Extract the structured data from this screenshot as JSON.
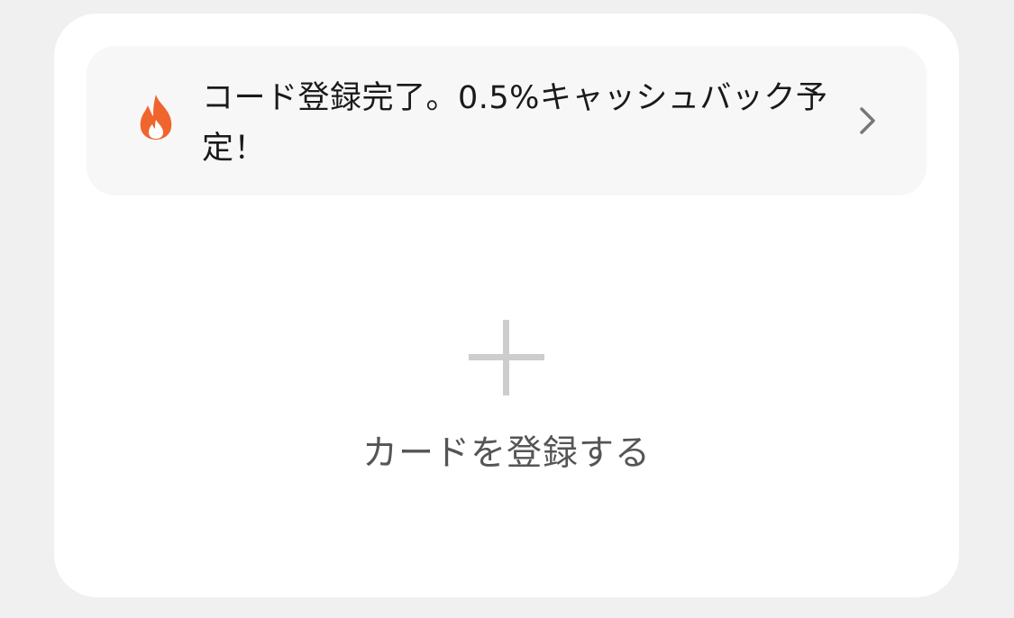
{
  "colors": {
    "page_background": "#f0f0f0",
    "card_background": "#ffffff",
    "banner_background": "#f7f7f7",
    "fire_accent": "#f0642e",
    "plus_color": "#cdcdcd",
    "chevron_color": "#777777"
  },
  "banner": {
    "icon": "fire-icon",
    "text": "コード登録完了。0.5%キャッシュバック予定！",
    "chevron": "chevron-right-icon"
  },
  "add_card": {
    "icon": "plus-icon",
    "label": "カードを登録する"
  }
}
